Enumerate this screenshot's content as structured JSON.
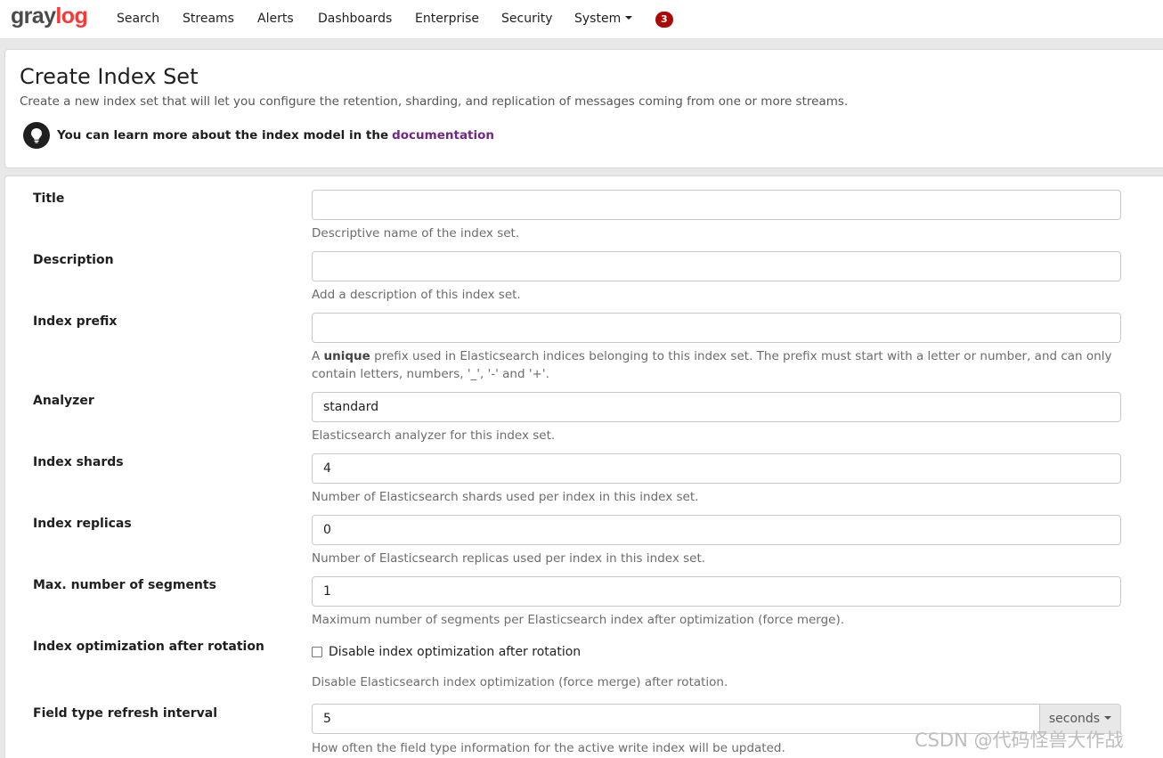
{
  "nav": {
    "logo_part1": "gray",
    "logo_part2": "log",
    "items": [
      "Search",
      "Streams",
      "Alerts",
      "Dashboards",
      "Enterprise",
      "Security",
      "System"
    ],
    "notifications_count": "3"
  },
  "header": {
    "title": "Create Index Set",
    "description": "Create a new index set that will let you configure the retention, sharding, and replication of messages coming from one or more streams.",
    "doc_hint": "You can learn more about the index model in the",
    "doc_link": "documentation"
  },
  "form": {
    "title": {
      "label": "Title",
      "value": "",
      "help": "Descriptive name of the index set."
    },
    "description": {
      "label": "Description",
      "value": "",
      "help": "Add a description of this index set."
    },
    "index_prefix": {
      "label": "Index prefix",
      "value": "",
      "help_pre": "A",
      "help_bold": "unique",
      "help_post": "prefix used in Elasticsearch indices belonging to this index set. The prefix must start with a letter or number, and can only contain letters, numbers, '_', '-' and '+'."
    },
    "analyzer": {
      "label": "Analyzer",
      "value": "standard",
      "help": "Elasticsearch analyzer for this index set."
    },
    "index_shards": {
      "label": "Index shards",
      "value": "4",
      "help": "Number of Elasticsearch shards used per index in this index set."
    },
    "index_replicas": {
      "label": "Index replicas",
      "value": "0",
      "help": "Number of Elasticsearch replicas used per index in this index set."
    },
    "max_segments": {
      "label": "Max. number of segments",
      "value": "1",
      "help": "Maximum number of segments per Elasticsearch index after optimization (force merge)."
    },
    "optimization": {
      "label": "Index optimization after rotation",
      "checkbox_label": "Disable index optimization after rotation",
      "checked": false,
      "help": "Disable Elasticsearch index optimization (force merge) after rotation."
    },
    "refresh_interval": {
      "label": "Field type refresh interval",
      "value": "5",
      "unit": "seconds",
      "help": "How often the field type information for the active write index will be updated."
    }
  },
  "watermark": "CSDN @代码怪兽大作战",
  "colors": {
    "brand_red": "#ff3633",
    "badge": "#ad0707",
    "link": "#702785"
  }
}
